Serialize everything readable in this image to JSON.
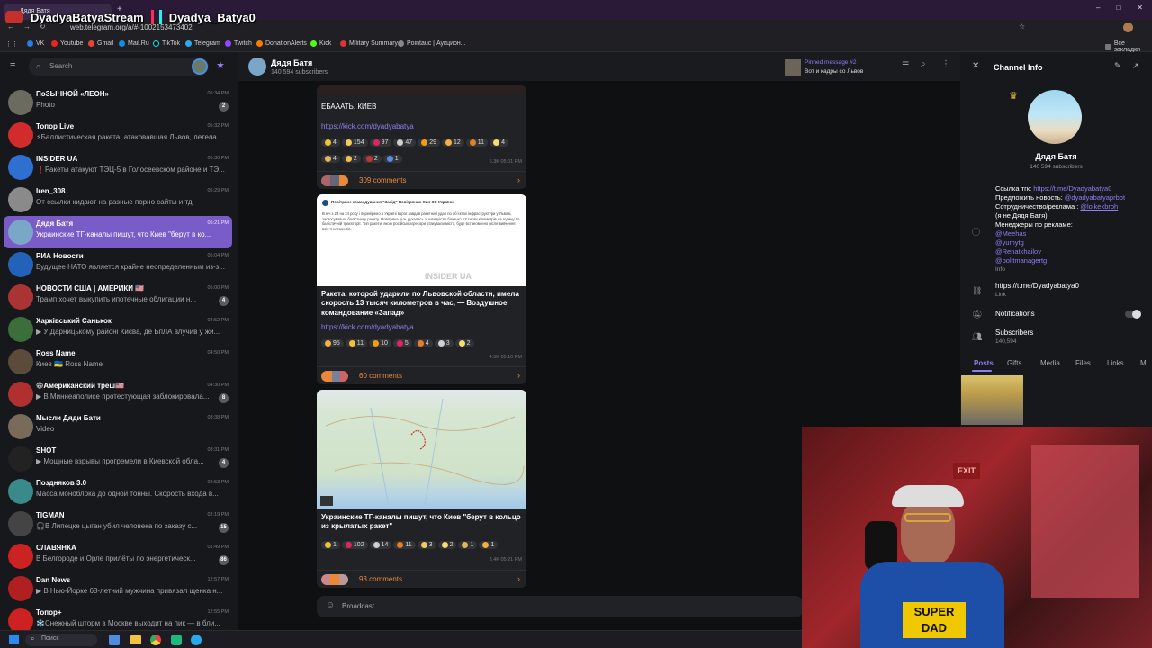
{
  "overlay": {
    "stream_name": "DyadyaBatyaStream",
    "tiktok_name": "Dyadya_Batya0"
  },
  "browser": {
    "tab_title": "Дядя Батя",
    "url": "web.telegram.org/a/#-1002153473402",
    "bookmarks": [
      "VK",
      "Youtube",
      "Gmail",
      "Mail.Ru",
      "TikTok",
      "Telegram",
      "Twitch",
      "DonationAlerts",
      "Kick",
      "Military Summary",
      "Pointauc | Аукцион..."
    ],
    "all_bookmarks": "Все закладки"
  },
  "sidebar": {
    "search_placeholder": "Search",
    "chats": [
      {
        "name": "ПоЗЫЧНОЙ «ЛЕОН»",
        "preview": "Photo",
        "time": "05:34 PM",
        "badge": "2",
        "color": "#6b6b60"
      },
      {
        "name": "Топор Live",
        "preview": "⚡Баллистическая ракета, атаковавшая Львов, летела...",
        "time": "05:32 PM",
        "badge": "",
        "color": "#d22b2b"
      },
      {
        "name": "INSIDER UA",
        "preview": "❗Ракеты атакуют ТЭЦ-5 в Голосеевском районе и ТЭ...",
        "time": "05:30 PM",
        "badge": "",
        "color": "#2f6fd1"
      },
      {
        "name": "Iren_308",
        "preview": "От ссылки кидают на разные порно сайты и тд",
        "time": "05:29 PM",
        "badge": "",
        "color": "#8a8a8a"
      },
      {
        "name": "Дядя Батя",
        "preview": "Украинские ТГ-каналы пишут, что Киев \"берут в ко...",
        "time": "05:21 PM",
        "badge": "",
        "color": "#7aa7c7",
        "active": true
      },
      {
        "name": "РИА Новости",
        "preview": "Будущее НАТО является крайне неопределенным из-з...",
        "time": "05:04 PM",
        "badge": "",
        "color": "#2262b8"
      },
      {
        "name": "НОВОСТИ США | АМЕРИКИ 🇺🇸",
        "preview": "Трамп хочет выкупить ипотечные облигации н...",
        "time": "05:00 PM",
        "badge": "4",
        "color": "#a33"
      },
      {
        "name": "Харківський Санькок",
        "preview": "▶ У Дарницькому районі Києва, де БпЛА влучив у жи...",
        "time": "04:52 PM",
        "badge": "",
        "color": "#3b6e3b"
      },
      {
        "name": "Ross Name",
        "preview": "Киев 🇺🇦 Ross Name",
        "time": "04:50 PM",
        "badge": "",
        "color": "#5c4a3a"
      },
      {
        "name": "😄Американский треш🇺🇸",
        "preview": "▶ В Миннеаполисе протестующая заблокировала...",
        "time": "04:30 PM",
        "badge": "8",
        "color": "#b03030"
      },
      {
        "name": "Мысли Дяди Бати",
        "preview": "Video",
        "time": "03:38 PM",
        "badge": "",
        "color": "#7a6a5a"
      },
      {
        "name": "SHOT",
        "preview": "▶ Мощные взрывы прогремели в Киевской обла...",
        "time": "03:31 PM",
        "badge": "4",
        "color": "#222"
      },
      {
        "name": "Поздняков 3.0",
        "preview": "Масса моноблока до одной тонны. Скорость входа в...",
        "time": "02:53 PM",
        "badge": "",
        "color": "#3a8a8a"
      },
      {
        "name": "TIGMAN",
        "preview": "🎧В Липецке цыган убил человека по заказу с...",
        "time": "02:19 PM",
        "badge": "15",
        "color": "#444"
      },
      {
        "name": "СЛАВЯНКА",
        "preview": "В Белгороде и Орле прилёты по энергетическ...",
        "time": "01:49 PM",
        "badge": "86",
        "color": "#c22"
      },
      {
        "name": "Dan News",
        "preview": "▶ В Нью-Йорке 68-летний мужчина привязал щенка н...",
        "time": "12:57 PM",
        "badge": "",
        "color": "#b02020"
      },
      {
        "name": "Топор+",
        "preview": "❄️Снежный шторм в Москве выходит на пик — в бли...",
        "time": "12:55 PM",
        "badge": "",
        "color": "#c22"
      }
    ]
  },
  "chat_header": {
    "title": "Дядя Батя",
    "subscribers": "140 594 subscribers",
    "pinned_label": "Pinned message #2",
    "pinned_text": "Вот и кадры со Львов"
  },
  "posts": [
    {
      "text": "ЕБАААТЬ. КИЕВ",
      "link": "https://kick.com/dyadyabatya",
      "reactions": [
        [
          "👍",
          "4"
        ],
        [
          "🥲",
          "154"
        ],
        [
          "❤️",
          "97"
        ],
        [
          "🕊",
          "47"
        ],
        [
          "😍",
          "29"
        ],
        [
          "😱",
          "12"
        ],
        [
          "🔥",
          "11"
        ],
        [
          "😁",
          "4"
        ],
        [
          "🤔",
          "4"
        ],
        [
          "👏",
          "2"
        ],
        [
          "💔",
          "2"
        ],
        [
          "🤝",
          "1"
        ]
      ],
      "meta": "6.3K  05:01 PM",
      "comments": "309 comments"
    },
    {
      "source_title": "Повітряне командування \"Захід\" Повітряних Сил ЗС України",
      "source_body": "В ніч з 23 на 24 року і перевірено в Україні ворог завдав ракетний удар по обʼєктах інфраструктури у Львові, застосувавши балістичну ракету. Повітряна ціль рухалась зі швидкістю близько 13 тисяч кілометрів на годину по балістичній траєкторії. Тип ракети, якою російські агресори атакували місто, буде встановлено після вивчення всіх її елементів.",
      "watermark": "INSIDER UA",
      "text": "Ракета, которой ударили по Львовской области, имела скорость 13 тысяч километров в час, — Воздушное командование «Запад»",
      "link": "https://kick.com/dyadyabatya",
      "reactions": [
        [
          "😱",
          "95"
        ],
        [
          "👍",
          "11"
        ],
        [
          "😍",
          "10"
        ],
        [
          "❤️",
          "5"
        ],
        [
          "🔥",
          "4"
        ],
        [
          "🕊",
          "3"
        ],
        [
          "😁",
          "2"
        ]
      ],
      "meta": "4.5K  05:10 PM",
      "comments": "60 comments"
    },
    {
      "text": "Украинские ТГ-каналы пишут, что Киев \"берут в кольцо из крылатых ракет\"",
      "reactions": [
        [
          "👍",
          "1"
        ],
        [
          "❤️",
          "102"
        ],
        [
          "🕊",
          "14"
        ],
        [
          "🔥",
          "11"
        ],
        [
          "🥲",
          "3"
        ],
        [
          "😁",
          "2"
        ],
        [
          "🤔",
          "1"
        ],
        [
          "😱",
          "1"
        ]
      ],
      "meta": "3.4K  05:21 PM",
      "comments": "93 comments"
    }
  ],
  "composer": {
    "placeholder": "Broadcast"
  },
  "channel_info": {
    "header": "Channel Info",
    "name": "Дядя Батя",
    "subscribers": "140 594 subscribers",
    "info_lines": [
      {
        "label": "Ссылка тгк: ",
        "value": "https://t.me/Dyadyabatya0"
      },
      {
        "label": "Предложить новость: ",
        "value": "@dyadyabatyaprbot"
      },
      {
        "label": "Сотрудничество/реклама : ",
        "value": "@lolkekbroh"
      },
      {
        "label": "(я не Дядя Батя)",
        "value": ""
      },
      {
        "label": "Менеджеры по рекламе:",
        "value": ""
      }
    ],
    "managers": [
      "@Meehas",
      "@yumytg",
      "@Renatkhailov",
      "@politmanagertg"
    ],
    "info_label": "Info",
    "link_value": "https://t.me/Dyadyabatya0",
    "link_label": "Link",
    "notifications_label": "Notifications",
    "subscribers_label": "Subscribers",
    "subscribers_count": "140,594",
    "tabs": [
      "Posts",
      "Gifts",
      "Media",
      "Files",
      "Links",
      "M"
    ]
  },
  "taskbar": {
    "search_placeholder": "Поиск"
  },
  "colors": {
    "accent": "#8f7cf2",
    "active_chat": "#7a5cc8",
    "comments": "#e9883b"
  }
}
